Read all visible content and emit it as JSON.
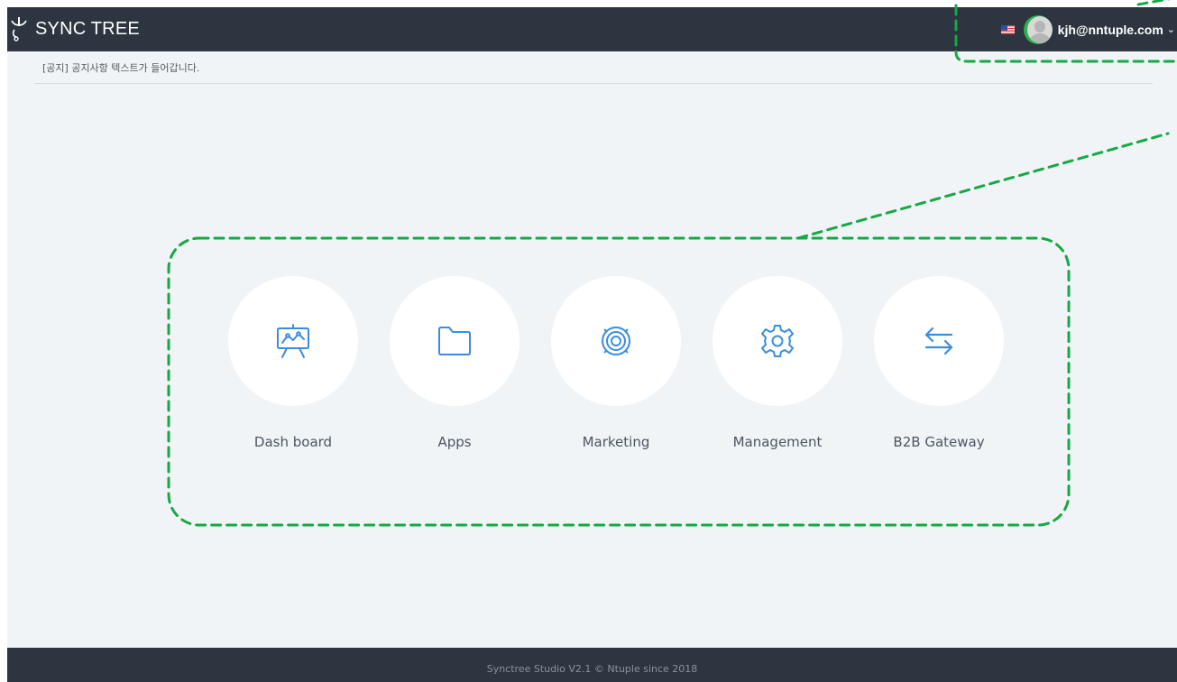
{
  "header": {
    "brand": "SYNC TREE",
    "user_email": "kjh@nntuple.com",
    "caret": "⌄"
  },
  "notice": {
    "text": "[공지] 공지사항 텍스트가 들어갑니다."
  },
  "menu": {
    "items": [
      {
        "label": "Dash board",
        "icon": "dashboard-easel-icon"
      },
      {
        "label": "Apps",
        "icon": "folder-icon"
      },
      {
        "label": "Marketing",
        "icon": "target-icon"
      },
      {
        "label": "Management",
        "icon": "gear-icon"
      },
      {
        "label": "B2B Gateway",
        "icon": "exchange-arrows-icon"
      }
    ]
  },
  "footer": {
    "text": "Synctree Studio V2.1 © Ntuple since 2018"
  },
  "colors": {
    "header_bg": "#2d3540",
    "page_bg": "#f1f4f7",
    "icon_blue": "#3a8dde",
    "annotation_green": "#17a844"
  }
}
